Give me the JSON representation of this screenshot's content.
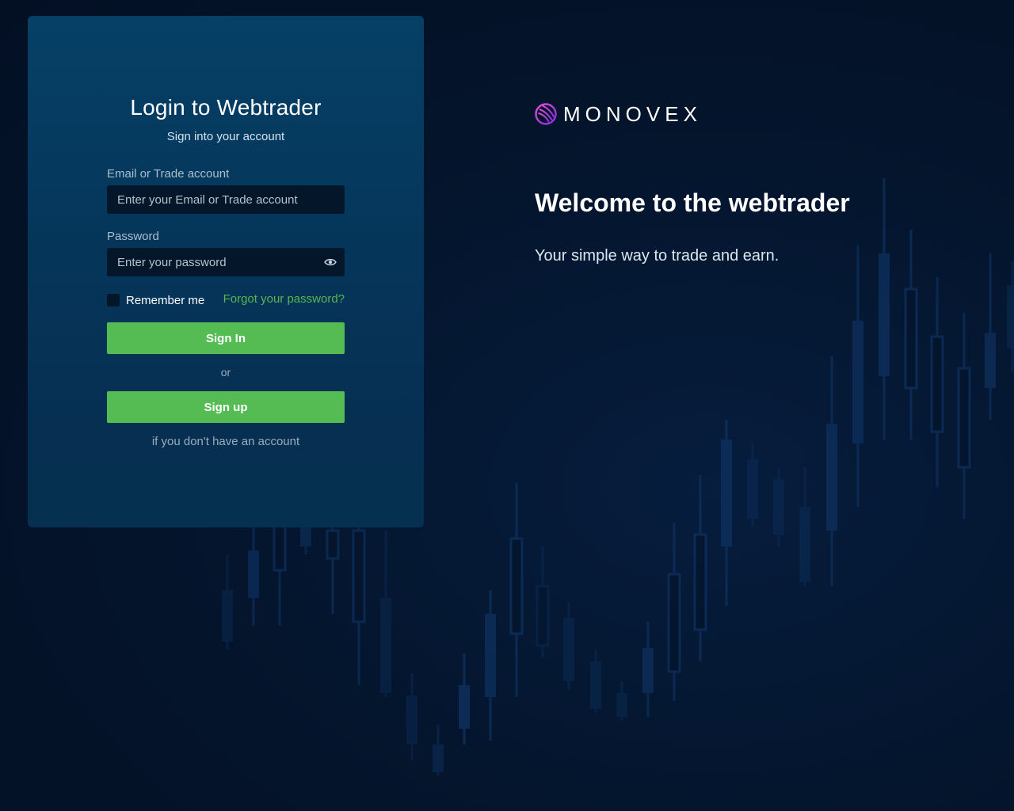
{
  "login": {
    "title": "Login to Webtrader",
    "subtitle": "Sign into your account",
    "email_label": "Email or Trade account",
    "email_placeholder": "Enter your Email or Trade account",
    "password_label": "Password",
    "password_placeholder": "Enter your password",
    "remember_label": "Remember me",
    "forgot_label": "Forgot your password?",
    "sign_in_label": "Sign In",
    "or_label": "or",
    "sign_up_label": "Sign up",
    "sign_up_hint": "if you don't have an account"
  },
  "brand": {
    "logo_text": "MONOVEX",
    "logo_icon": "globe-icon"
  },
  "hero": {
    "welcome": "Welcome to the webtrader",
    "tagline": "Your simple way to trade and earn."
  },
  "colors": {
    "background": "#04132a",
    "card": "#05365a",
    "input": "#041629",
    "accent_green": "#55bc54",
    "link_green": "#55b84f",
    "logo_magenta": "#c03bd6",
    "candle": "#0b2a55"
  },
  "icons": {
    "eye": "eye-icon"
  }
}
